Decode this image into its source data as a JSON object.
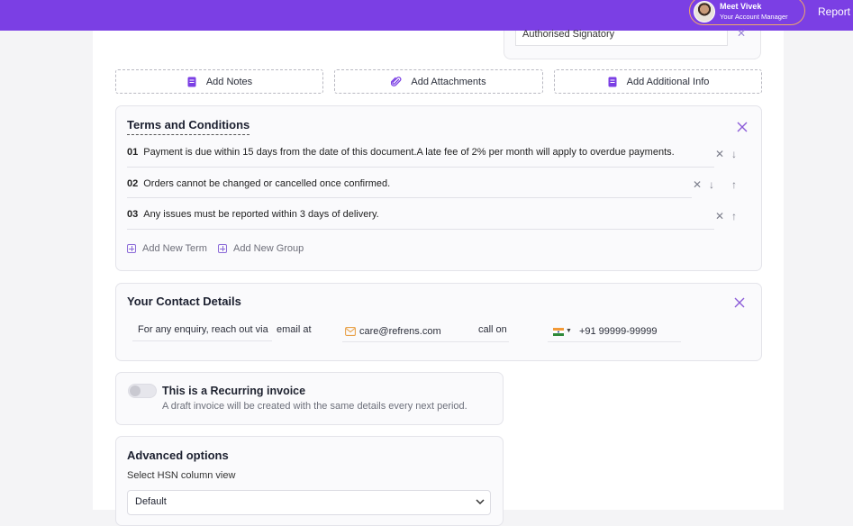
{
  "header": {
    "manager_name": "Meet Vivek",
    "manager_role": "Your Account Manager",
    "report_link": "Report a"
  },
  "signature": {
    "value": "Authorised Signatory"
  },
  "actions": {
    "add_notes": "Add Notes",
    "add_attachments": "Add Attachments",
    "add_additional_info": "Add Additional Info"
  },
  "terms": {
    "title": "Terms and Conditions",
    "items": [
      {
        "num": "01",
        "text": "Payment is due within 15 days from the date of this document.A late fee of 2% per month will apply to overdue payments."
      },
      {
        "num": "02",
        "text": "Orders cannot be changed or cancelled once confirmed."
      },
      {
        "num": "03",
        "text": "Any issues must be reported within 3 days of delivery."
      }
    ],
    "add_term": "Add New Term",
    "add_group": "Add New Group"
  },
  "contact": {
    "title": "Your Contact Details",
    "enquiry_text": "For any enquiry, reach out via",
    "email_label": "email at",
    "email": "care@refrens.com",
    "call_label": "call on",
    "phone": "+91 99999-99999"
  },
  "recurring": {
    "title": "This is a Recurring invoice",
    "description": "A draft invoice will be created with the same details every next period.",
    "enabled": false
  },
  "advanced": {
    "title": "Advanced options",
    "hsn_label": "Select HSN column view",
    "hsn_value": "Default"
  },
  "colors": {
    "brand": "#7b3fe4",
    "accent_icon": "#8b6ad8",
    "email_icon": "#e8a24a"
  }
}
